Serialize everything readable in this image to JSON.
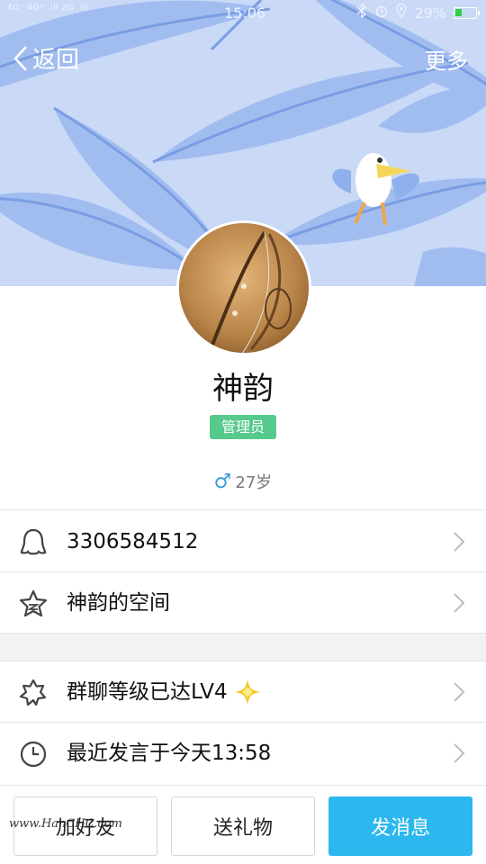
{
  "status_bar": {
    "network_left": "4G⁺ 4G⁺ .ıll  2G .ıll",
    "time": "15:06",
    "battery_text": "29%",
    "icons": [
      "bluetooth-icon",
      "alarm-icon",
      "location-icon",
      "battery-icon"
    ]
  },
  "nav": {
    "back_label": "返回",
    "more_label": "更多"
  },
  "profile": {
    "name": "神韵",
    "role": "管理员",
    "gender_symbol": "♂",
    "age": "27岁"
  },
  "info_rows": [
    {
      "icon": "qq-penguin-icon",
      "label": "3306584512"
    },
    {
      "icon": "star-space-icon",
      "label": "神韵的空间"
    },
    {
      "icon": "level-star-icon",
      "label": "群聊等级已达LV4",
      "badge_icon": "diamond-badge-icon"
    },
    {
      "icon": "clock-icon",
      "label": "最近发言于今天13:58"
    }
  ],
  "actions": {
    "add_friend": "加好友",
    "send_gift": "送礼物",
    "send_message": "发消息"
  },
  "watermark": "www.HanCHC.com",
  "colors": {
    "header_bg": "#c9d9f6",
    "feather": "#8fb0ec",
    "role_badge": "#56c98c",
    "message_button": "#2cb7ef"
  }
}
